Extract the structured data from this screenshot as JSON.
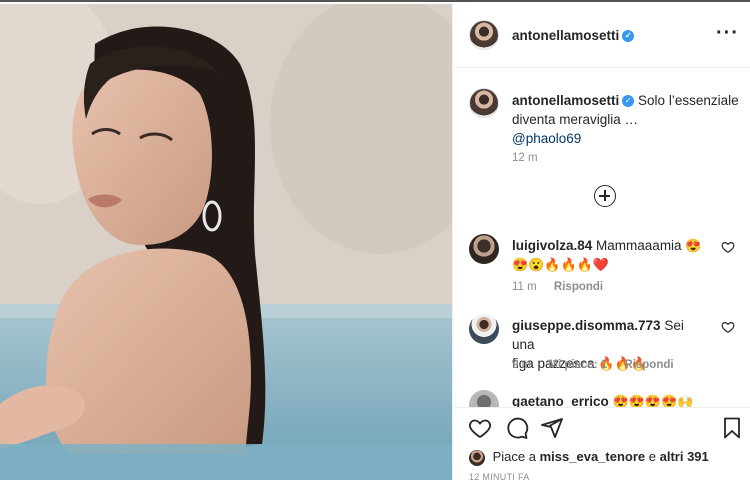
{
  "post": {
    "username": "antonellamosetti",
    "caption_line1": "Solo l’essenziale",
    "caption_line2": "diventa meraviglia …",
    "caption_mention": "@phaolo69",
    "caption_time": "12 m"
  },
  "comments": [
    {
      "username": "luigivolza.84",
      "text": "Mammaaamia",
      "emoji1": "😍",
      "emoji_line2": "😍😮🔥🔥🔥❤️",
      "time": "11 m",
      "reply": "Rispondi"
    },
    {
      "username": "giuseppe.disomma.773",
      "text": "Sei una",
      "text2": "figa pazzesca",
      "emoji_line": "🔥🔥🔥",
      "time": "9 m",
      "likes": "Mi piace: 1",
      "reply": "Rispondi"
    },
    {
      "username": "gaetano_errico",
      "emoji_line": "😍😍😍😍🙌"
    }
  ],
  "likes": {
    "prefix": "Piace a",
    "user": "miss_eva_tenore",
    "middle": "e",
    "others": "altri 391"
  },
  "post_time": "12 MINUTI FA",
  "icons": [
    "more-icon",
    "verified-icon",
    "plus-circle-icon",
    "heart-icon",
    "comment-icon",
    "share-icon",
    "bookmark-icon"
  ],
  "colors": {
    "verified": "#3897f0",
    "mention": "#00376b",
    "muted": "#8e8e8e",
    "divider": "#efefef"
  }
}
